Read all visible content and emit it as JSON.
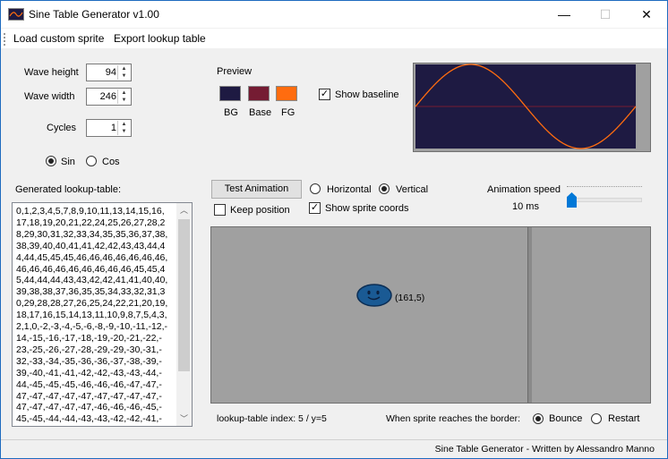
{
  "window": {
    "title": "Sine Table Generator v1.00",
    "minimize": "—",
    "maximize": "☐",
    "close": "✕"
  },
  "menu": {
    "load": "Load custom sprite",
    "export": "Export lookup table"
  },
  "wave": {
    "height_label": "Wave height",
    "height_value": "94",
    "width_label": "Wave width",
    "width_value": "246",
    "cycles_label": "Cycles",
    "cycles_value": "1",
    "sin_label": "Sin",
    "cos_label": "Cos",
    "selected": "Sin"
  },
  "preview": {
    "label": "Preview",
    "bg_label": "BG",
    "bg_color": "#1e1a42",
    "base_label": "Base",
    "base_color": "#751c33",
    "fg_label": "FG",
    "fg_color": "#ff6c0f",
    "show_baseline_label": "Show baseline",
    "show_baseline_checked": true
  },
  "lookup": {
    "label": "Generated lookup-table:",
    "text": "0,1,2,3,4,5,7,8,9,10,11,13,14,15,16,\n17,18,19,20,21,22,24,25,26,27,28,2\n8,29,30,31,32,33,34,35,35,36,37,38,\n38,39,40,40,41,41,42,42,43,43,44,4\n4,44,45,45,45,46,46,46,46,46,46,46,\n46,46,46,46,46,46,46,46,46,45,45,4\n5,44,44,44,43,43,42,42,41,41,40,40,\n39,38,38,37,36,35,35,34,33,32,31,3\n0,29,28,28,27,26,25,24,22,21,20,19,\n18,17,16,15,14,13,11,10,9,8,7,5,4,3,\n2,1,0,-2,-3,-4,-5,-6,-8,-9,-10,-11,-12,-\n14,-15,-16,-17,-18,-19,-20,-21,-22,-\n23,-25,-26,-27,-28,-29,-29,-30,-31,-\n32,-33,-34,-35,-36,-36,-37,-38,-39,-\n39,-40,-41,-41,-42,-42,-43,-43,-44,-\n44,-45,-45,-45,-46,-46,-46,-47,-47,-\n47,-47,-47,-47,-47,-47,-47,-47,-47,-\n47,-47,-47,-47,-47,-46,-46,-46,-45,-\n45,-45,-44,-44,-43,-43,-42,-42,-41,-"
  },
  "animation": {
    "test_button": "Test Animation",
    "horizontal_label": "Horizontal",
    "vertical_label": "Vertical",
    "selected_direction": "Vertical",
    "keep_position_label": "Keep position",
    "keep_position_checked": false,
    "show_coords_label": "Show sprite coords",
    "show_coords_checked": true,
    "speed_label": "Animation speed",
    "speed_value": "10 ms",
    "speed_fraction": 0.0,
    "sprite_coords": "(161,5)",
    "index_text": "lookup-table index: 5 / y=5",
    "border_label": "When sprite reaches the border:",
    "bounce_label": "Bounce",
    "restart_label": "Restart",
    "selected_border": "Bounce"
  },
  "status": {
    "text": "Sine Table Generator - Written by Alessandro Manno"
  }
}
